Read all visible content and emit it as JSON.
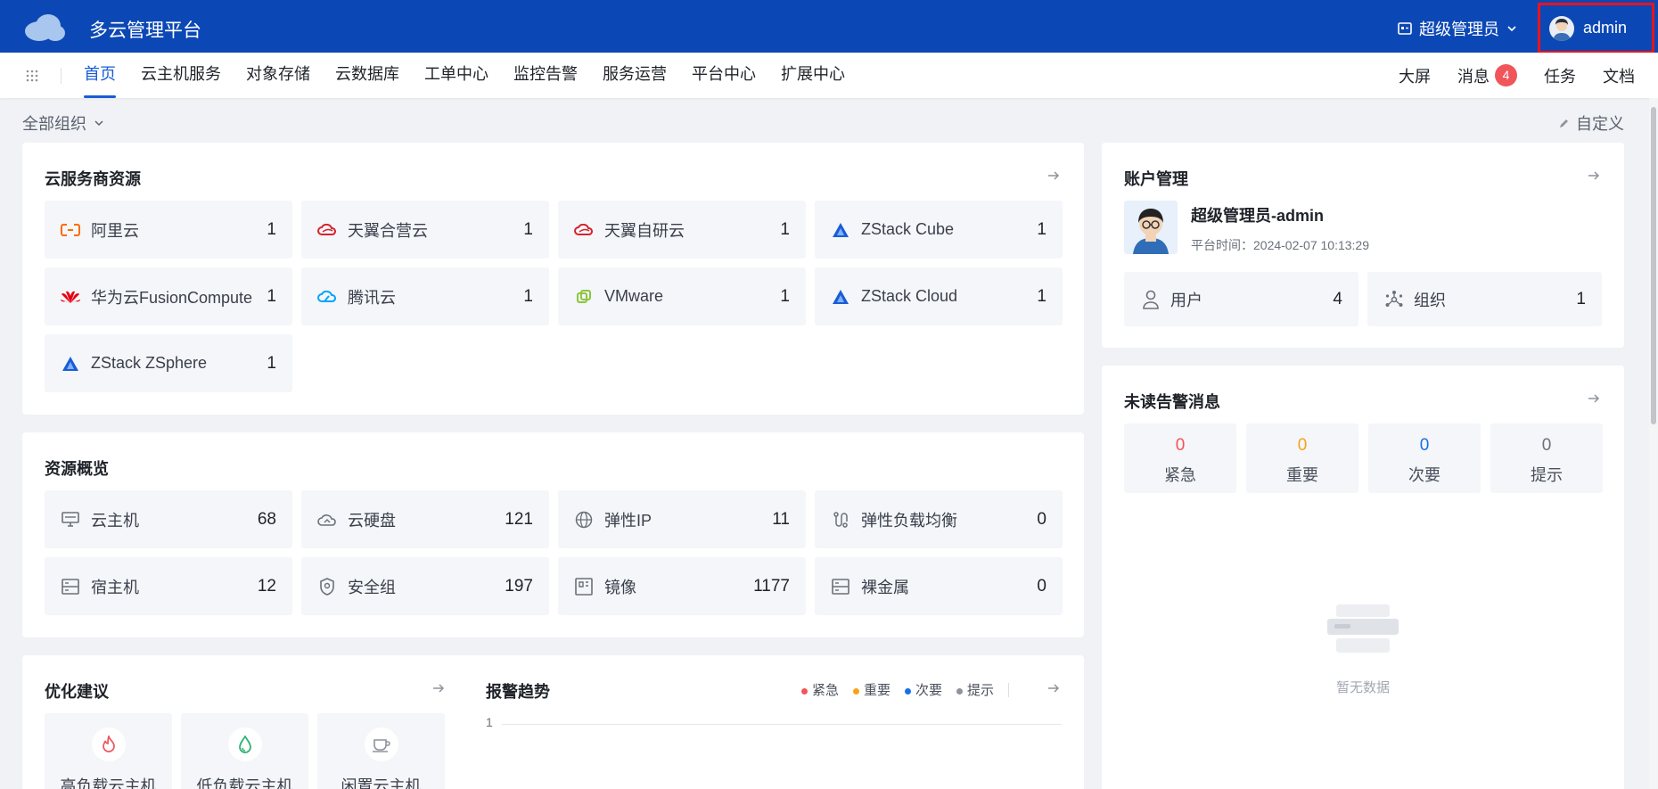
{
  "header": {
    "app_title": "多云管理平台",
    "role": "超级管理员",
    "username": "admin"
  },
  "nav": {
    "items": [
      "首页",
      "云主机服务",
      "对象存储",
      "云数据库",
      "工单中心",
      "监控告警",
      "服务运营",
      "平台中心",
      "扩展中心"
    ],
    "active_index": 0,
    "right": {
      "big_screen": "大屏",
      "messages": "消息",
      "message_count": "4",
      "tasks": "任务",
      "docs": "文档"
    }
  },
  "filter": {
    "org": "全部组织",
    "customize": "自定义"
  },
  "cloud_providers": {
    "title": "云服务商资源",
    "items": [
      {
        "label": "阿里云",
        "value": "1",
        "icon": "aliyun-icon"
      },
      {
        "label": "天翼合营云",
        "value": "1",
        "icon": "tianyi-icon"
      },
      {
        "label": "天翼自研云",
        "value": "1",
        "icon": "tianyi-icon"
      },
      {
        "label": "ZStack Cube",
        "value": "1",
        "icon": "zstack-icon"
      },
      {
        "label": "华为云FusionCompute",
        "value": "1",
        "icon": "huawei-icon"
      },
      {
        "label": "腾讯云",
        "value": "1",
        "icon": "tencent-icon"
      },
      {
        "label": "VMware",
        "value": "1",
        "icon": "vmware-icon"
      },
      {
        "label": "ZStack Cloud",
        "value": "1",
        "icon": "zstack-icon"
      },
      {
        "label": "ZStack ZSphere",
        "value": "1",
        "icon": "zstack-icon"
      }
    ]
  },
  "resources": {
    "title": "资源概览",
    "items": [
      {
        "label": "云主机",
        "value": "68",
        "icon": "monitor-icon"
      },
      {
        "label": "云硬盘",
        "value": "121",
        "icon": "cloud-disk-icon"
      },
      {
        "label": "弹性IP",
        "value": "11",
        "icon": "globe-icon"
      },
      {
        "label": "弹性负载均衡",
        "value": "0",
        "icon": "load-balancer-icon"
      },
      {
        "label": "宿主机",
        "value": "12",
        "icon": "server-icon"
      },
      {
        "label": "安全组",
        "value": "197",
        "icon": "shield-icon"
      },
      {
        "label": "镜像",
        "value": "1177",
        "icon": "image-icon"
      },
      {
        "label": "裸金属",
        "value": "0",
        "icon": "server-icon"
      }
    ]
  },
  "optimization": {
    "title": "优化建议",
    "items": [
      {
        "label": "高负载云主机",
        "icon": "fire-icon"
      },
      {
        "label": "低负载云主机",
        "icon": "drop-icon"
      },
      {
        "label": "闲置云主机",
        "icon": "cup-icon"
      }
    ]
  },
  "alarm_trend": {
    "title": "报警趋势",
    "legend": [
      "紧急",
      "重要",
      "次要",
      "提示"
    ],
    "legend_colors": [
      "#f0555a",
      "#f7a21b",
      "#1a6fe8",
      "#8e939c"
    ],
    "y_tick": "1"
  },
  "account": {
    "title": "账户管理",
    "name": "超级管理员-admin",
    "time_label": "平台时间：",
    "time_value": "2024-02-07 10:13:29",
    "users_label": "用户",
    "users_value": "4",
    "orgs_label": "组织",
    "orgs_value": "1"
  },
  "alerts": {
    "title": "未读告警消息",
    "items": [
      {
        "label": "紧急",
        "value": "0",
        "color": "#f0555a"
      },
      {
        "label": "重要",
        "value": "0",
        "color": "#f7a21b"
      },
      {
        "label": "次要",
        "value": "0",
        "color": "#1a6fe8"
      },
      {
        "label": "提示",
        "value": "0",
        "color": "#6b7079"
      }
    ],
    "empty_text": "暂无数据"
  }
}
